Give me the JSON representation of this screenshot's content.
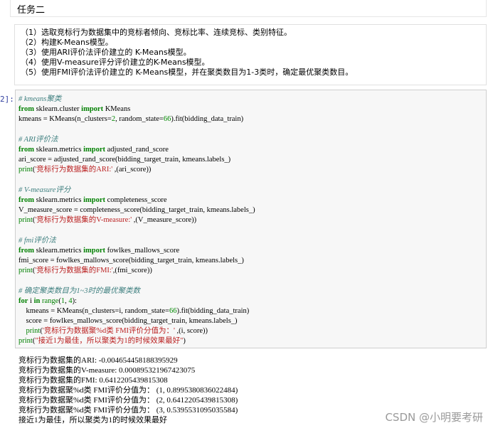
{
  "markdown_title": "任务二",
  "task_list": [
    "（1）选取竞标行为数据集中的竞标者倾向、竞标比率、连续竞标、类别特征。",
    "（2）构建K-Means模型。",
    "（3）使用ARI评价法评价建立的 K-Means模型。",
    "（4）使用V-measure评分评价建立的K-Means模型。",
    "（5）使用FMI评价法评价建立的 K-Means模型，并在聚类数目为1-3类时，确定最优聚类数目。"
  ],
  "code_cell": {
    "prompt": "2]:",
    "lines": {
      "l01": "# kmeans聚类",
      "l02_kw1": "from",
      "l02_mod": " sklearn.cluster ",
      "l02_kw2": "import",
      "l02_name": " KMeans",
      "l03_a": "kmeans = KMeans(n_clusters=",
      "l03_n1": "2",
      "l03_b": ", random_state=",
      "l03_n2": "66",
      "l03_c": ").fit(bidding_data_train)",
      "l05": "# ARI评价法",
      "l06_kw1": "from",
      "l06_mod": " sklearn.metrics ",
      "l06_kw2": "import",
      "l06_name": " adjusted_rand_score",
      "l07": "ari_score = adjusted_rand_score(bidding_target_train, kmeans.labels_)",
      "l08_fn": "print",
      "l08_a": "(",
      "l08_s": "'竞标行为数据集的ARI:'",
      "l08_b": " ,(ari_score))",
      "l10": "# V-measure评分",
      "l11_kw1": "from",
      "l11_mod": " sklearn.metrics ",
      "l11_kw2": "import",
      "l11_name": " completeness_score",
      "l12": "V_measure_score = completeness_score(bidding_target_train, kmeans.labels_)",
      "l13_fn": "print",
      "l13_a": "(",
      "l13_s": "'竞标行为数据集的V-measure:'",
      "l13_b": " ,(V_measure_score))",
      "l15": "# fmi评价法",
      "l16_kw1": "from",
      "l16_mod": " sklearn.metrics ",
      "l16_kw2": "import",
      "l16_name": " fowlkes_mallows_score",
      "l17": "fmi_score = fowlkes_mallows_score(bidding_target_train, kmeans.labels_)",
      "l18_fn": "print",
      "l18_a": "(",
      "l18_s": "'竞标行为数据集的FMI:'",
      "l18_b": ",(fmi_score))",
      "l20": "# 确定聚类数目为1~3时的最优聚类数",
      "l21_kw1": "for",
      "l21_a": " i ",
      "l21_kw2": "in",
      "l21_sp": " ",
      "l21_fn": "range",
      "l21_b": "(",
      "l21_n1": "1",
      "l21_c": ", ",
      "l21_n2": "4",
      "l21_d": "):",
      "l22_a": "    kmeans = KMeans(n_clusters=i, random_state=",
      "l22_n": "66",
      "l22_b": ").fit(bidding_data_train)",
      "l23": "    score = fowlkes_mallows_score(bidding_target_train, kmeans.labels_)",
      "l24_ind": "    ",
      "l24_fn": "print",
      "l24_a": "(",
      "l24_s": "'竞标行为数据聚%d类 FMI评价分值为：'",
      "l24_b": " ,(i, score))",
      "l25_fn": "print",
      "l25_a": "(",
      "l25_s": "\"接近1为最佳，所以聚类为1的时候效果最好\"",
      "l25_b": ")"
    }
  },
  "output_lines": [
    "竞标行为数据集的ARI: -0.004654458188395929",
    "竞标行为数据集的V-measure: 0.000895321967423075",
    "竞标行为数据集的FMI: 0.6412205439815308",
    "竞标行为数据聚%d类 FMI评价分值为： (1, 0.8995380836022484)",
    "竞标行为数据聚%d类 FMI评价分值为： (2, 0.6412205439815308)",
    "竞标行为数据聚%d类 FMI评价分值为： (3, 0.5395531095035584)",
    "接近1为最佳，所以聚类为1的时候效果最好"
  ],
  "watermark": "CSDN @小明要考研",
  "colors": {
    "keyword": "#008000",
    "string": "#ba2121",
    "comment": "#408080",
    "number": "#008800",
    "prompt": "#303f9f"
  }
}
